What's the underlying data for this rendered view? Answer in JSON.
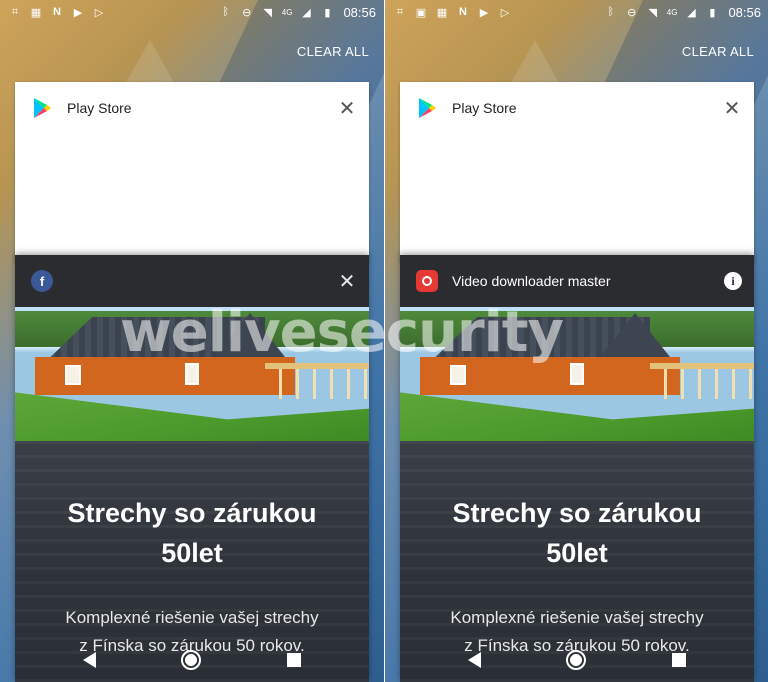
{
  "status_bar": {
    "time": "08:56",
    "network": "4G",
    "left_icons": [
      "usb-icon",
      "image-icon",
      "keyboard-icon",
      "n-notification-icon",
      "play-icon",
      "play-outline-icon"
    ],
    "right_icons": [
      "bluetooth-icon",
      "dnd-icon",
      "wifi-icon",
      "signal-icon",
      "battery-icon"
    ]
  },
  "recents": {
    "clear_all_label": "CLEAR ALL"
  },
  "play_store_card": {
    "title": "Play Store"
  },
  "left_screen": {
    "ad_card": {
      "app_icon": "facebook-icon",
      "title": ""
    }
  },
  "right_screen": {
    "ad_card": {
      "app_icon": "video-downloader-icon",
      "title": "Video downloader master"
    }
  },
  "ad": {
    "headline_line1": "Strechy so zárukou",
    "headline_line2": "50let",
    "desc_line1": "Komplexné riešenie vašej strechy",
    "desc_line2": "z Fínska so zárukou 50 rokov."
  },
  "watermark": "welivesecurity",
  "colors": {
    "facebook_blue": "#3b5998",
    "video_red": "#e53935",
    "card_dark": "#2a2c30"
  }
}
